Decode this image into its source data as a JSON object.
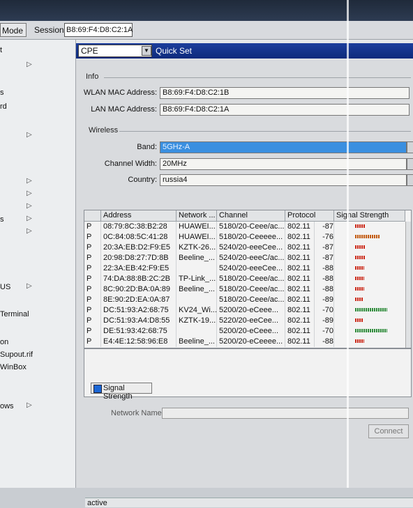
{
  "topbar": {
    "mode_label": "Mode",
    "session_label": "Session:",
    "session_value": "B8:69:F4:D8:C2:1A"
  },
  "sidebar": {
    "items": [
      "t",
      "",
      "s",
      "rd",
      "",
      "",
      "",
      "",
      "",
      "s",
      "",
      "",
      "US",
      "",
      "Terminal",
      "",
      "on",
      "Supout.rif",
      "WinBox",
      "",
      "ows"
    ]
  },
  "header": {
    "mode_select": "CPE",
    "title": "Quick Set"
  },
  "info": {
    "group": "Info",
    "wlan_mac_label": "WLAN MAC Address:",
    "wlan_mac": "B8:69:F4:D8:C2:1B",
    "lan_mac_label": "LAN MAC Address:",
    "lan_mac": "B8:69:F4:D8:C2:1A"
  },
  "wireless": {
    "group": "Wireless",
    "band_label": "Band:",
    "band": "5GHz-A",
    "channel_width_label": "Channel Width:",
    "channel_width": "20MHz",
    "country_label": "Country:",
    "country": "russia4"
  },
  "scan_table": {
    "columns": [
      "",
      "Address",
      "Network ...",
      "Channel",
      "Protocol",
      "Signal Strength"
    ],
    "rows": [
      {
        "flag": "P",
        "address": "08:79:8C:38:B2:28",
        "network": "HUAWEI...",
        "channel": "5180/20-Ceee/ac...",
        "protocol": "802.11",
        "signal": "-87"
      },
      {
        "flag": "P",
        "address": "0C:84:08:5C:41:28",
        "network": "HUAWEI...",
        "channel": "5180/20-Ceeeee...",
        "protocol": "802.11",
        "signal": "-76"
      },
      {
        "flag": "P",
        "address": "20:3A:EB:D2:F9:E5",
        "network": "KZTK-26...",
        "channel": "5240/20-eeeCee...",
        "protocol": "802.11",
        "signal": "-87"
      },
      {
        "flag": "P",
        "address": "20:98:D8:27:7D:8B",
        "network": "Beeline_...",
        "channel": "5240/20-eeeC/ac...",
        "protocol": "802.11",
        "signal": "-87"
      },
      {
        "flag": "P",
        "address": "22:3A:EB:42:F9:E5",
        "network": "",
        "channel": "5240/20-eeeCee...",
        "protocol": "802.11",
        "signal": "-88"
      },
      {
        "flag": "P",
        "address": "74:DA:88:8B:2C:2B",
        "network": "TP-Link_...",
        "channel": "5180/20-Ceee/ac...",
        "protocol": "802.11",
        "signal": "-88"
      },
      {
        "flag": "P",
        "address": "8C:90:2D:BA:0A:89",
        "network": "Beeline_...",
        "channel": "5180/20-Ceee/ac...",
        "protocol": "802.11",
        "signal": "-88"
      },
      {
        "flag": "P",
        "address": "8E:90:2D:EA:0A:87",
        "network": "",
        "channel": "5180/20-Ceee/ac...",
        "protocol": "802.11",
        "signal": "-89"
      },
      {
        "flag": "P",
        "address": "DC:51:93:A2:68:75",
        "network": "KV24_Wi...",
        "channel": "5200/20-eCeee...",
        "protocol": "802.11",
        "signal": "-70"
      },
      {
        "flag": "P",
        "address": "DC:51:93:A4:D8:55",
        "network": "KZTK-19...",
        "channel": "5220/20-eeCee...",
        "protocol": "802.11",
        "signal": "-89"
      },
      {
        "flag": "P",
        "address": "DE:51:93:42:68:75",
        "network": "",
        "channel": "5200/20-eCeee...",
        "protocol": "802.11",
        "signal": "-70"
      },
      {
        "flag": "P",
        "address": "E4:4E:12:58:96:E8",
        "network": "Beeline_...",
        "channel": "5200/20-eCeeee...",
        "protocol": "802.11",
        "signal": "-88"
      }
    ]
  },
  "graph": {
    "legend": "Signal Strength",
    "legend_color": "#1b67d6"
  },
  "network_name": {
    "label": "Network Name:",
    "value": ""
  },
  "connect_label": "Connect",
  "status": "active"
}
